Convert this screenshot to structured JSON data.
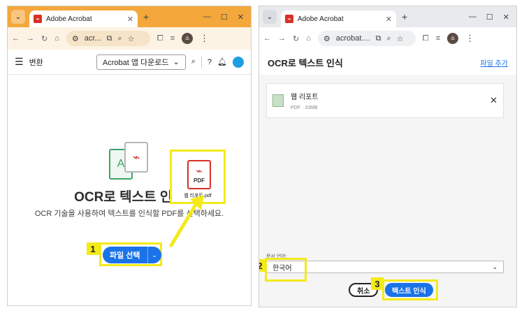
{
  "left": {
    "tab_title": "Adobe Acrobat",
    "url": "acr...",
    "header": {
      "convert_label": "변환",
      "download_label": "Acrobat 앱 다운로드"
    },
    "title": "OCR로 텍스트 인식",
    "subtitle": "OCR 기술을 사용하여 텍스트를 인식할 PDF를 선택하세요.",
    "illus_letter": "A",
    "pdf_card": {
      "type_label": "PDF",
      "filename": "웹 리포트.pdf"
    },
    "select_button": "파일 선택",
    "step": "1"
  },
  "right": {
    "tab_title": "Adobe Acrobat",
    "url": "acrobat....",
    "title": "OCR로 텍스트 인식",
    "add_file": "파일 추가",
    "file": {
      "name": "웹 리포트",
      "size": "PDF · 10MB"
    },
    "lang_label": "문서 언어:",
    "lang_value": "한국어",
    "cancel_label": "취소",
    "ocr_label": "텍스트 인식",
    "step2": "2",
    "step3": "3"
  },
  "icons": [
    "chevron-down-icon",
    "close-icon",
    "plus-icon",
    "back-icon",
    "forward-icon",
    "reload-icon",
    "home-icon",
    "site-info-icon",
    "zoom-icon",
    "star-icon",
    "extensions-icon",
    "menu-icon",
    "search-icon",
    "help-icon",
    "bell-icon"
  ],
  "colors": {
    "accent": "#1a73e8",
    "highlight": "#f3ea1a",
    "browser_tab_left": "#f4a73b",
    "pdf_red": "#d93025"
  }
}
